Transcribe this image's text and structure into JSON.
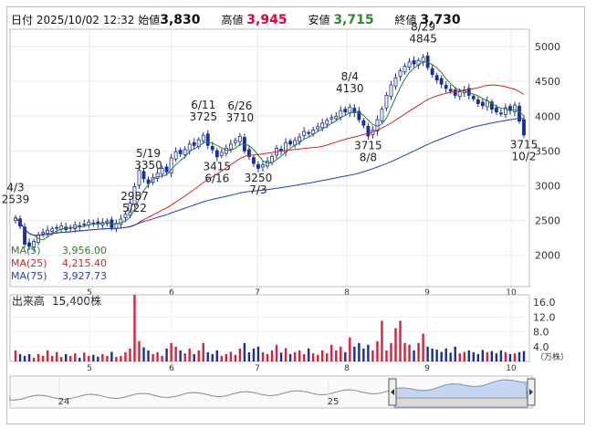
{
  "header": {
    "date_label": "日付",
    "datetime": "2025/10/02 12:32",
    "open_label": "始値",
    "open": "3,830",
    "high_label": "高値",
    "high": "3,945",
    "low_label": "安値",
    "low": "3,715",
    "close_label": "終値",
    "close": "3,730",
    "colors": {
      "high": "#e0003a",
      "low": "#2e8b2e",
      "bull_candle": "#ffffff",
      "bear_candle": "#1a2f9a"
    }
  },
  "chart_data": [
    {
      "type": "candlestick",
      "title": "",
      "y_ticks": [
        2000,
        2500,
        3000,
        3500,
        4000,
        4500,
        5000
      ],
      "ylim": [
        1550,
        5250
      ],
      "x_ticks": [
        "5",
        "6",
        "7",
        "8",
        "9",
        "10"
      ],
      "grid": true,
      "x_range_months": [
        4,
        10.1
      ],
      "closes": [
        2539,
        2420,
        2160,
        2130,
        2200,
        2290,
        2330,
        2360,
        2380,
        2390,
        2420,
        2370,
        2400,
        2440,
        2420,
        2450,
        2480,
        2460,
        2450,
        2470,
        2490,
        2400,
        2460,
        2520,
        2590,
        2750,
        2987,
        3220,
        3100,
        3030,
        3120,
        3180,
        3250,
        3200,
        3400,
        3490,
        3460,
        3520,
        3600,
        3580,
        3660,
        3725,
        3580,
        3520,
        3415,
        3480,
        3540,
        3600,
        3650,
        3710,
        3500,
        3420,
        3320,
        3250,
        3300,
        3350,
        3420,
        3540,
        3500,
        3620,
        3600,
        3650,
        3700,
        3780,
        3760,
        3800,
        3850,
        3900,
        3940,
        3980,
        4000,
        4080,
        4060,
        4130,
        4050,
        3950,
        3870,
        3715,
        3800,
        3950,
        4100,
        4300,
        4450,
        4550,
        4650,
        4720,
        4780,
        4750,
        4800,
        4845,
        4700,
        4600,
        4520,
        4460,
        4400,
        4360,
        4300,
        4350,
        4380,
        4300,
        4250,
        4180,
        4150,
        4220,
        4100,
        4060,
        4040,
        4120,
        4080,
        4160,
        3930,
        3730
      ],
      "moving_averages": [
        {
          "name": "MA(5)",
          "value": "3,956.00",
          "period": 5,
          "color": "#2e7d2e"
        },
        {
          "name": "MA(25)",
          "value": "4,215.40",
          "period": 25,
          "color": "#d92020"
        },
        {
          "name": "MA(75)",
          "value": "3,927.73",
          "period": 75,
          "color": "#1f3fc8"
        }
      ],
      "annotations": [
        {
          "text": "4/3",
          "text2": "2539",
          "idx": 0,
          "side": "above"
        },
        {
          "text": "5/19",
          "text2": "3350",
          "idx": 29,
          "side": "above"
        },
        {
          "text": "2987",
          "text2": "5/22",
          "idx": 26,
          "side": "below"
        },
        {
          "text": "6/11",
          "text2": "3725",
          "idx": 41,
          "side": "above"
        },
        {
          "text": "3415",
          "text2": "6/16",
          "idx": 44,
          "side": "below"
        },
        {
          "text": "6/26",
          "text2": "3710",
          "idx": 49,
          "side": "above"
        },
        {
          "text": "3250",
          "text2": "7/3",
          "idx": 53,
          "side": "below"
        },
        {
          "text": "8/4",
          "text2": "4130",
          "idx": 73,
          "side": "above"
        },
        {
          "text": "3715",
          "text2": "8/8",
          "idx": 77,
          "side": "below"
        },
        {
          "text": "8/29",
          "text2": "4845",
          "idx": 89,
          "side": "above"
        },
        {
          "text": "3715",
          "text2": "10/2",
          "idx": 111,
          "side": "below"
        }
      ]
    },
    {
      "type": "bar",
      "title": "出来高",
      "latest_volume": "15,400株",
      "unit": "（万株）",
      "y_ticks": [
        "4.0",
        "8.0",
        "12.0",
        "16.0"
      ],
      "ylim": [
        0,
        18
      ],
      "values": [
        3,
        2,
        1.5,
        2,
        1,
        2,
        1.5,
        3,
        1.5,
        2.5,
        1.2,
        2,
        1.5,
        2.2,
        1,
        2.4,
        1.5,
        1.8,
        1.3,
        2,
        1.5,
        2.6,
        1.2,
        1.5,
        2.5,
        3.5,
        18,
        5.5,
        3.8,
        3,
        2,
        2.5,
        1.5,
        3.5,
        5,
        4,
        3,
        2.2,
        3.5,
        2,
        3,
        5,
        2.5,
        2,
        3,
        1.5,
        2,
        2.6,
        1.8,
        3.5,
        5,
        2.5,
        3.5,
        4,
        2.5,
        2,
        3,
        4.5,
        2.4,
        3.6,
        2,
        2.5,
        3,
        2,
        3.5,
        2.2,
        1.8,
        3,
        2.2,
        4.5,
        3,
        4,
        2.5,
        6.5,
        4,
        5,
        3.5,
        4.5,
        3,
        5.5,
        11,
        3,
        5,
        9,
        11,
        5,
        4.5,
        3,
        5,
        7.5,
        4,
        3.5,
        3.2,
        2.6,
        3.5,
        2.4,
        4,
        2.2,
        2.6,
        3,
        2.5,
        2,
        3.1,
        2.5,
        2.8,
        2.2,
        3,
        2.5,
        2,
        2.2,
        2.5,
        2.8
      ],
      "x_ticks": [
        "5",
        "6",
        "7",
        "8",
        "9",
        "10"
      ]
    },
    {
      "type": "area",
      "title": "navigator",
      "x_ticks": [
        "24",
        "25"
      ]
    }
  ]
}
